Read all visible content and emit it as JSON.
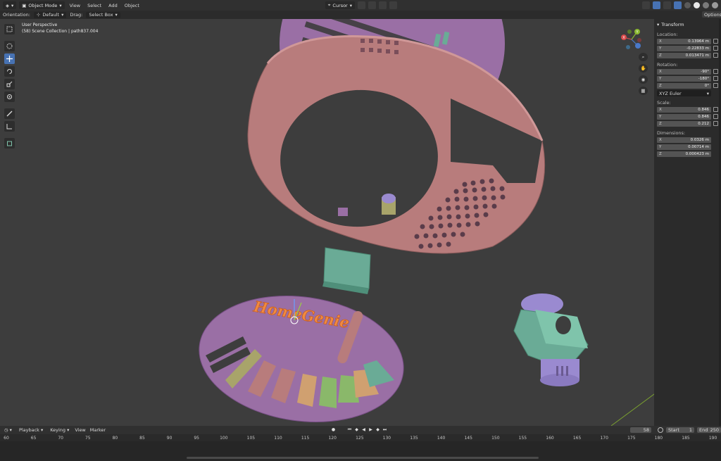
{
  "header": {
    "mode": "Object Mode",
    "menus": [
      "View",
      "Select",
      "Add",
      "Object"
    ],
    "pivot": "Cursor"
  },
  "tool_settings": {
    "orientation_label": "Orientation:",
    "orientation_value": "Default",
    "drag_label": "Drag:",
    "drag_value": "Select Box",
    "options_label": "Options"
  },
  "viewport": {
    "perspective": "User Perspective",
    "collection": "(58) Scene Collection | path837.004",
    "logo_text": "HomeGenie"
  },
  "toolbar_tools": [
    "select-box-tool",
    "cursor-tool",
    "move-tool",
    "rotate-tool",
    "scale-tool",
    "transform-tool",
    "annotate-tool",
    "measure-tool",
    "add-cube-tool"
  ],
  "gizmo_axes": {
    "x": "X",
    "y": "Y",
    "z": "Z"
  },
  "transform_panel": {
    "title": "Transform",
    "location_label": "Location:",
    "location": [
      {
        "axis": "X",
        "value": "0.13964 m"
      },
      {
        "axis": "Y",
        "value": "-0.22833 m"
      },
      {
        "axis": "Z",
        "value": "0.013471 m"
      }
    ],
    "rotation_label": "Rotation:",
    "rotation": [
      {
        "axis": "X",
        "value": "-90°"
      },
      {
        "axis": "Y",
        "value": "-180°"
      },
      {
        "axis": "Z",
        "value": "0°"
      }
    ],
    "rotation_mode": "XYZ Euler",
    "scale_label": "Scale:",
    "scale": [
      {
        "axis": "X",
        "value": "0.846"
      },
      {
        "axis": "Y",
        "value": "0.846"
      },
      {
        "axis": "Z",
        "value": "0.212"
      }
    ],
    "dimensions_label": "Dimensions:",
    "dimensions": [
      {
        "axis": "X",
        "value": "0.0326 m"
      },
      {
        "axis": "Y",
        "value": "0.00714 m"
      },
      {
        "axis": "Z",
        "value": "0.000423 m"
      }
    ]
  },
  "timeline": {
    "menus": [
      "Playback",
      "Keying",
      "View",
      "Marker"
    ],
    "current_frame": "58",
    "start_label": "Start",
    "start": "1",
    "end_label": "End",
    "end": "250",
    "ruler": [
      "60",
      "65",
      "70",
      "75",
      "80",
      "85",
      "90",
      "95",
      "100",
      "105",
      "110",
      "115",
      "120",
      "125",
      "130",
      "135",
      "140",
      "145",
      "150",
      "155",
      "160",
      "165",
      "170",
      "175",
      "180",
      "185",
      "190"
    ]
  },
  "colors": {
    "viewport_bg": "#3d3d3d",
    "active_blue": "#4772b3",
    "ring_pink": "#b87c7c",
    "disk_purple": "#9a6fa5",
    "teal": "#6aab96",
    "olive": "#a8a46a"
  }
}
